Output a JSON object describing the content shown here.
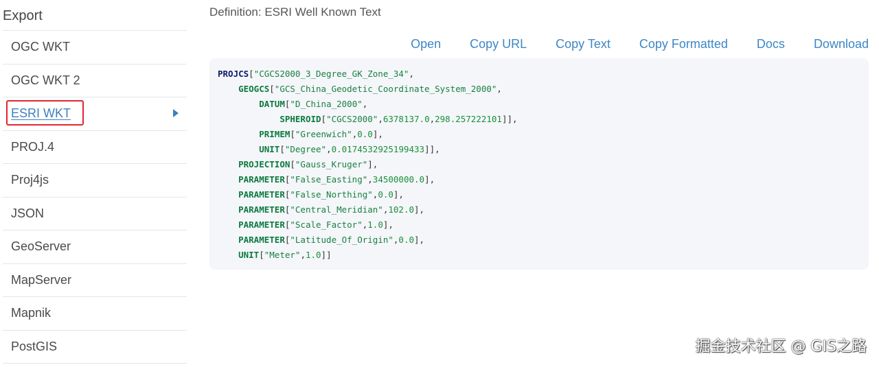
{
  "sidebar": {
    "title": "Export",
    "items": [
      {
        "label": "OGC WKT"
      },
      {
        "label": "OGC WKT 2"
      },
      {
        "label": "ESRI WKT",
        "active": true
      },
      {
        "label": "PROJ.4"
      },
      {
        "label": "Proj4js"
      },
      {
        "label": "JSON"
      },
      {
        "label": "GeoServer"
      },
      {
        "label": "MapServer"
      },
      {
        "label": "Mapnik"
      },
      {
        "label": "PostGIS"
      }
    ]
  },
  "main": {
    "definition_title": "Definition: ESRI Well Known Text",
    "actions": [
      "Open",
      "Copy URL",
      "Copy Text",
      "Copy Formatted",
      "Docs",
      "Download"
    ],
    "code_lines": [
      {
        "indent": 0,
        "tokens": [
          [
            "kw root",
            "PROJCS"
          ],
          [
            "punc",
            "["
          ],
          [
            "str",
            "\"CGCS2000_3_Degree_GK_Zone_34\""
          ],
          [
            "punc",
            ","
          ]
        ]
      },
      {
        "indent": 1,
        "tokens": [
          [
            "kw",
            "GEOGCS"
          ],
          [
            "punc",
            "["
          ],
          [
            "str",
            "\"GCS_China_Geodetic_Coordinate_System_2000\""
          ],
          [
            "punc",
            ","
          ]
        ]
      },
      {
        "indent": 2,
        "tokens": [
          [
            "kw",
            "DATUM"
          ],
          [
            "punc",
            "["
          ],
          [
            "str",
            "\"D_China_2000\""
          ],
          [
            "punc",
            ","
          ]
        ]
      },
      {
        "indent": 3,
        "tokens": [
          [
            "kw",
            "SPHEROID"
          ],
          [
            "punc",
            "["
          ],
          [
            "str",
            "\"CGCS2000\""
          ],
          [
            "punc",
            ","
          ],
          [
            "num",
            "6378137.0"
          ],
          [
            "punc",
            ","
          ],
          [
            "num",
            "298.257222101"
          ],
          [
            "punc",
            "]],"
          ]
        ]
      },
      {
        "indent": 2,
        "tokens": [
          [
            "kw",
            "PRIMEM"
          ],
          [
            "punc",
            "["
          ],
          [
            "str",
            "\"Greenwich\""
          ],
          [
            "punc",
            ","
          ],
          [
            "num",
            "0.0"
          ],
          [
            "punc",
            "],"
          ]
        ]
      },
      {
        "indent": 2,
        "tokens": [
          [
            "kw",
            "UNIT"
          ],
          [
            "punc",
            "["
          ],
          [
            "str",
            "\"Degree\""
          ],
          [
            "punc",
            ","
          ],
          [
            "num",
            "0.0174532925199433"
          ],
          [
            "punc",
            "]],"
          ]
        ]
      },
      {
        "indent": 1,
        "tokens": [
          [
            "kw",
            "PROJECTION"
          ],
          [
            "punc",
            "["
          ],
          [
            "str",
            "\"Gauss_Kruger\""
          ],
          [
            "punc",
            "],"
          ]
        ]
      },
      {
        "indent": 1,
        "tokens": [
          [
            "kw",
            "PARAMETER"
          ],
          [
            "punc",
            "["
          ],
          [
            "str",
            "\"False_Easting\""
          ],
          [
            "punc",
            ","
          ],
          [
            "num",
            "34500000.0"
          ],
          [
            "punc",
            "],"
          ]
        ]
      },
      {
        "indent": 1,
        "tokens": [
          [
            "kw",
            "PARAMETER"
          ],
          [
            "punc",
            "["
          ],
          [
            "str",
            "\"False_Northing\""
          ],
          [
            "punc",
            ","
          ],
          [
            "num",
            "0.0"
          ],
          [
            "punc",
            "],"
          ]
        ]
      },
      {
        "indent": 1,
        "tokens": [
          [
            "kw",
            "PARAMETER"
          ],
          [
            "punc",
            "["
          ],
          [
            "str",
            "\"Central_Meridian\""
          ],
          [
            "punc",
            ","
          ],
          [
            "num",
            "102.0"
          ],
          [
            "punc",
            "],"
          ]
        ]
      },
      {
        "indent": 1,
        "tokens": [
          [
            "kw",
            "PARAMETER"
          ],
          [
            "punc",
            "["
          ],
          [
            "str",
            "\"Scale_Factor\""
          ],
          [
            "punc",
            ","
          ],
          [
            "num",
            "1.0"
          ],
          [
            "punc",
            "],"
          ]
        ]
      },
      {
        "indent": 1,
        "tokens": [
          [
            "kw",
            "PARAMETER"
          ],
          [
            "punc",
            "["
          ],
          [
            "str",
            "\"Latitude_Of_Origin\""
          ],
          [
            "punc",
            ","
          ],
          [
            "num",
            "0.0"
          ],
          [
            "punc",
            "],"
          ]
        ]
      },
      {
        "indent": 1,
        "tokens": [
          [
            "kw",
            "UNIT"
          ],
          [
            "punc",
            "["
          ],
          [
            "str",
            "\"Meter\""
          ],
          [
            "punc",
            ","
          ],
          [
            "num",
            "1.0"
          ],
          [
            "punc",
            "]]"
          ]
        ]
      }
    ]
  },
  "watermark": "掘金技术社区 @ GIS之路",
  "colors": {
    "accent": "#3d86c6",
    "highlight_border": "#e0262e",
    "code_bg": "#f4f6f9",
    "keyword": "#0b7a3e",
    "root_keyword": "#0d1a6b"
  }
}
